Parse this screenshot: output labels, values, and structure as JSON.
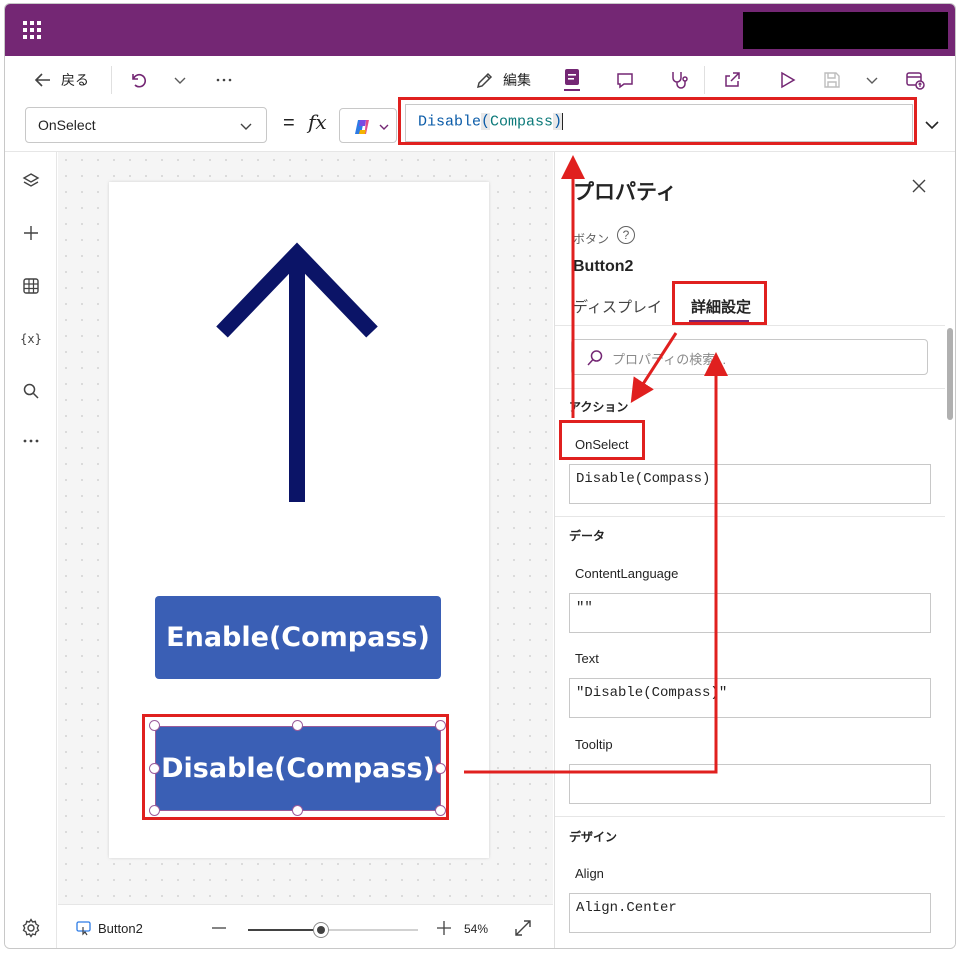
{
  "command_bar": {
    "back_label": "戻る",
    "edit_label": "編集"
  },
  "formula_bar": {
    "property": "OnSelect",
    "equals": "=",
    "fx": "fx",
    "formula_fn": "Disable",
    "formula_open": "(",
    "formula_arg": "Compass",
    "formula_close": ")"
  },
  "canvas": {
    "enable_button": "Enable(Compass)",
    "disable_button": "Disable(Compass)"
  },
  "status_bar": {
    "selected": "Button2",
    "zoom": "54%",
    "zoom_level": 0.54
  },
  "properties_panel": {
    "title": "プロパティ",
    "type": "ボタン",
    "help": "?",
    "name": "Button2",
    "tabs": [
      "ディスプレイ",
      "詳細設定"
    ],
    "search_placeholder": "プロパティの検索...",
    "sections": {
      "action": "アクション",
      "data": "データ",
      "design": "デザイン"
    },
    "props": [
      {
        "label": "OnSelect",
        "value": "Disable(Compass)"
      },
      {
        "label": "ContentLanguage",
        "value": "\"\""
      },
      {
        "label": "Text",
        "value": "\"Disable(Compass)\""
      },
      {
        "label": "Tooltip",
        "value": ""
      },
      {
        "label": "Align",
        "value": "Align.Center"
      }
    ]
  },
  "colors": {
    "topbar": "#742774",
    "button": "#3a5fb5",
    "arrow": "#0b1467",
    "annotation": "#e0201f"
  }
}
